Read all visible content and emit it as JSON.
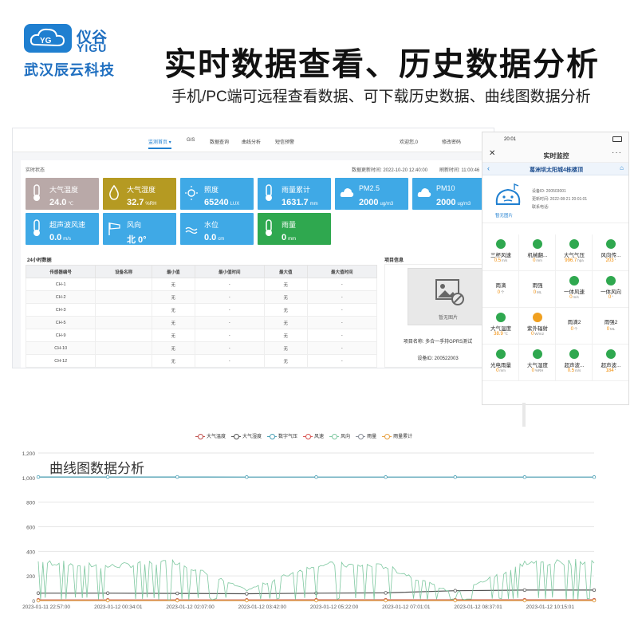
{
  "colors": {
    "brand": "#1f7fd0",
    "tile_gray": "#b9a9a8",
    "tile_olive": "#b59a22",
    "tile_blue": "#3fa9e6",
    "tile_green": "#2fa84f"
  },
  "brand": {
    "name_cn": "仪谷",
    "name_en": "YIGU",
    "company": "武汉辰云科技"
  },
  "headline": "实时数据查看、历史数据分析",
  "subline": "手机/PC端可远程查看数据、可下载历史数据、曲线图数据分析",
  "web": {
    "nav": [
      {
        "label": "监测首页 ▾",
        "active": true
      },
      {
        "label": "GIS"
      },
      {
        "label": "数据查询"
      },
      {
        "label": "曲线分析"
      },
      {
        "label": "短信预警"
      }
    ],
    "welcome": "欢迎您,0",
    "change_password": "修改密码",
    "status_label": "实时状态",
    "update_time": "数据更新时间: 2022-10-20 12:40:00",
    "refresh": "刷新时间: 11:00:46",
    "tiles": [
      {
        "name": "大气温度",
        "value": "24.0",
        "unit": "℃",
        "icon": "thermometer-icon",
        "color": "gray"
      },
      {
        "name": "大气湿度",
        "value": "32.7",
        "unit": "%RH",
        "icon": "humidity-icon",
        "color": "olive"
      },
      {
        "name": "照度",
        "value": "65240",
        "unit": "LUX",
        "icon": "sun-icon",
        "color": "blue"
      },
      {
        "name": "雨量累计",
        "value": "1631.7",
        "unit": "mm",
        "icon": "thermometer-icon",
        "color": "blue"
      },
      {
        "name": "PM2.5",
        "value": "2000",
        "unit": "ug/m3",
        "icon": "cloud-icon",
        "color": "blue"
      },
      {
        "name": "PM10",
        "value": "2000",
        "unit": "ug/m3",
        "icon": "cloud-icon",
        "color": "blue"
      },
      {
        "name": "超声波风速",
        "value": "0.0",
        "unit": "m/s",
        "icon": "thermometer-icon",
        "color": "blue"
      },
      {
        "name": "风向",
        "value": "北  0°",
        "unit": "",
        "icon": "windsock-icon",
        "color": "blue"
      },
      {
        "name": "水位",
        "value": "0.0",
        "unit": "cm",
        "icon": "water-icon",
        "color": "blue"
      },
      {
        "name": "雨量",
        "value": "0",
        "unit": "mm",
        "icon": "thermometer-icon",
        "color": "green"
      }
    ],
    "table_title": "24小时数据",
    "table_headers": [
      "传感器编号",
      "设备名称",
      "最小值",
      "最小值时间",
      "最大值",
      "最大值时间"
    ],
    "table_rows": [
      [
        "CH-1",
        "",
        "无",
        "-",
        "无",
        "-"
      ],
      [
        "CH-2",
        "",
        "无",
        "-",
        "无",
        "-"
      ],
      [
        "CH-3",
        "",
        "无",
        "-",
        "无",
        "-"
      ],
      [
        "CH-5",
        "",
        "无",
        "-",
        "无",
        "-"
      ],
      [
        "CH-9",
        "",
        "无",
        "-",
        "无",
        "-"
      ],
      [
        "CH-10",
        "",
        "无",
        "-",
        "无",
        "-"
      ],
      [
        "CH-12",
        "",
        "无",
        "-",
        "无",
        "-"
      ]
    ],
    "project_title": "项目信息",
    "no_image": "暂无图片",
    "project_name": "项目名称: 多合一手持GPRS测试",
    "device_id": "设备ID: 200522003"
  },
  "phone": {
    "time": "20:01",
    "title": "实时监控",
    "site": "葛洲坝太阳城4栋楼顶",
    "no_image": "暂无图片",
    "device_id": "设备ID: 200503001",
    "update": "更新时间: 2022-08-21 20:01:01",
    "contact": "联系电话:",
    "cells": [
      {
        "name": "三杯风速",
        "value": "0.5",
        "unit": "m/s",
        "icon": "green"
      },
      {
        "name": "机械翻...",
        "value": "0",
        "unit": "mm",
        "icon": "green"
      },
      {
        "name": "大气气压",
        "value": "996.7",
        "unit": "hpa",
        "icon": "green"
      },
      {
        "name": "风向传...",
        "value": "203",
        "unit": "°",
        "icon": "green"
      },
      {
        "name": "雨滴",
        "value": "0",
        "unit": "个",
        "icon": ""
      },
      {
        "name": "雨强",
        "value": "0",
        "unit": "ML",
        "icon": ""
      },
      {
        "name": "一体风速",
        "value": "0",
        "unit": "m/s",
        "icon": "green"
      },
      {
        "name": "一体风向",
        "value": "0",
        "unit": "°",
        "icon": "green"
      },
      {
        "name": "大气温度",
        "value": "38.9",
        "unit": "℃",
        "icon": "green"
      },
      {
        "name": "紫外辐射",
        "value": "0",
        "unit": "W/m2",
        "icon": "orange"
      },
      {
        "name": "雨滴2",
        "value": "0",
        "unit": "个",
        "icon": ""
      },
      {
        "name": "雨强2",
        "value": "0",
        "unit": "ML",
        "icon": ""
      },
      {
        "name": "光电雨量",
        "value": "0",
        "unit": "mm",
        "icon": "green"
      },
      {
        "name": "大气湿度",
        "value": "0",
        "unit": "%RH",
        "icon": "green"
      },
      {
        "name": "超声波...",
        "value": "0.5",
        "unit": "m/s",
        "icon": "green"
      },
      {
        "name": "超声波...",
        "value": "184",
        "unit": "°",
        "icon": "green"
      }
    ]
  },
  "chart_data": {
    "type": "line",
    "title": "曲线图数据分析",
    "ylim": [
      0,
      1200
    ],
    "y_ticks": [
      "0",
      "200",
      "400",
      "600",
      "800",
      "1,000",
      "1,200"
    ],
    "x_ticks": [
      "2023-01-11 22:57:00",
      "2023-01-12 00:34:01",
      "2023-01-12 02:07:00",
      "2023-01-12 03:42:00",
      "2023-01-12 05:22:00",
      "2023-01-12 07:01:01",
      "2023-01-12 08:37:01",
      "2023-01-12 10:15:01"
    ],
    "legend": [
      "大气温度",
      "大气湿度",
      "数字气压",
      "风速",
      "风向",
      "雨量",
      "雨量累计"
    ],
    "series": [
      {
        "name": "大气温度",
        "color": "#c0504d",
        "values": [
          5,
          5,
          5,
          5,
          6,
          6,
          6,
          6,
          6
        ]
      },
      {
        "name": "大气湿度",
        "color": "#555555",
        "values": [
          60,
          60,
          58,
          55,
          60,
          62,
          80,
          85,
          85
        ]
      },
      {
        "name": "数字气压",
        "color": "#4aa0b5",
        "values": [
          1005,
          1005,
          1005,
          1004,
          1004,
          1004,
          1004,
          1004,
          1004
        ]
      },
      {
        "name": "风速",
        "color": "#d9534f",
        "values": [
          2,
          2,
          2,
          2,
          2,
          2,
          2,
          2,
          2
        ]
      },
      {
        "name": "风向",
        "color": "#7ec8a0",
        "values": [
          340,
          300,
          340,
          90,
          320,
          300,
          60,
          330,
          340
        ]
      },
      {
        "name": "雨量",
        "color": "#8a8f99",
        "values": [
          0,
          0,
          0,
          0,
          0,
          0,
          0,
          0,
          0
        ]
      },
      {
        "name": "雨量累计",
        "color": "#e8a040",
        "values": [
          0,
          0,
          0,
          0,
          0,
          0,
          0,
          0,
          0
        ]
      }
    ]
  }
}
